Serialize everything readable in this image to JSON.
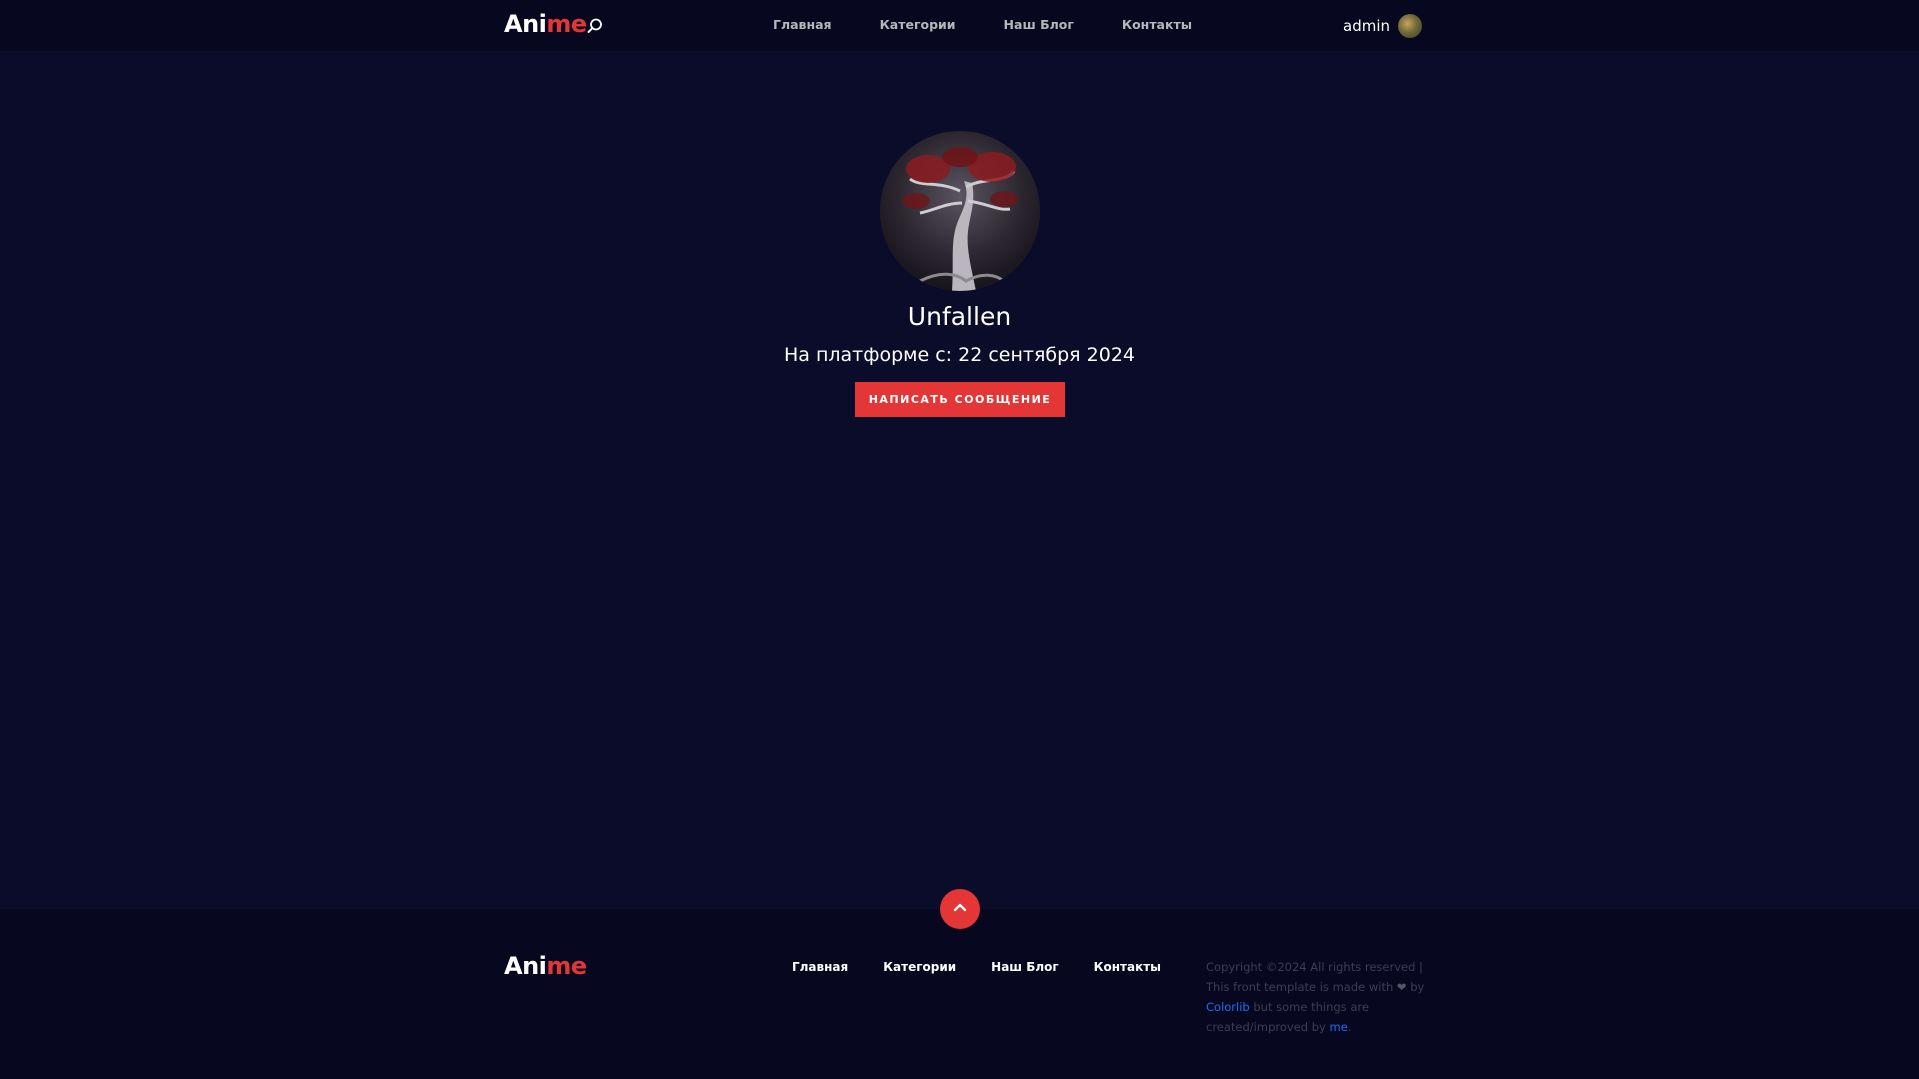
{
  "brand": {
    "logo_part1": "Ani",
    "logo_part2": "me",
    "accent_color": "#e53637"
  },
  "header": {
    "nav": [
      "Главная",
      "Категории",
      "Наш Блог",
      "Контакты"
    ],
    "user_name": "admin"
  },
  "profile": {
    "username": "Unfallen",
    "since": "На платформе с: 22 сентября 2024",
    "message_button": "НАПИСАТЬ СООБЩЕНИЕ"
  },
  "footer": {
    "nav": [
      "Главная",
      "Категории",
      "Наш Блог",
      "Контакты"
    ],
    "copyright_1": "Copyright ©2024 All rights reserved | This front template is made with",
    "heart": "❤",
    "copyright_2": "by",
    "link_1": "Colorlib",
    "copyright_3": "but some things are created/improved by",
    "link_2": "me",
    "copyright_4": "."
  }
}
